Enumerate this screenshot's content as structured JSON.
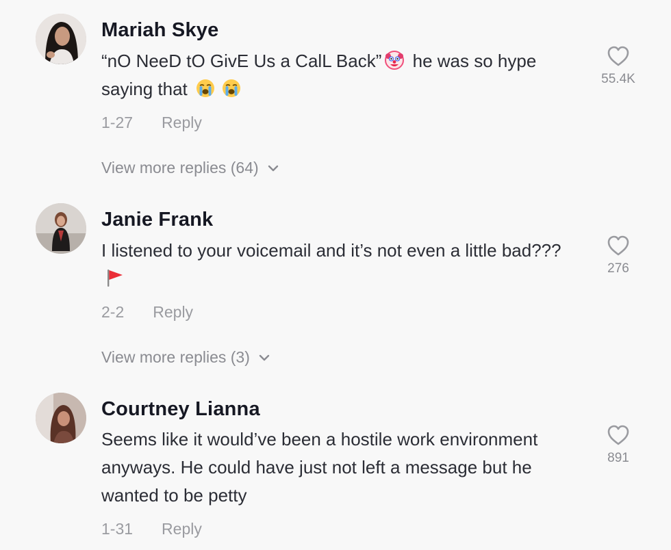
{
  "comments": [
    {
      "username": "Mariah Skye",
      "text_part1": "“nO NeeD tO GivE Us a CalL Back”",
      "text_part2": "he was so hype saying that",
      "date": "1-27",
      "reply_label": "Reply",
      "likes": "55.4K",
      "view_more": "View more replies (64)",
      "emojis": [
        "clown-face",
        "loudly-crying-face",
        "loudly-crying-face"
      ]
    },
    {
      "username": "Janie Frank",
      "text_part1": "I listened to your voicemail and it’s not even a little bad???",
      "date": "2-2",
      "reply_label": "Reply",
      "likes": "276",
      "view_more": "View more replies (3)",
      "emojis": [
        "red-flag"
      ]
    },
    {
      "username": "Courtney Lianna",
      "text_part1": "Seems like it would’ve been a hostile work environment anyways. He could have just not left a message but he wanted to be petty",
      "date": "1-31",
      "reply_label": "Reply",
      "likes": "891"
    }
  ],
  "icons": {
    "like": "heart-outline-icon",
    "expand": "chevron-down-icon"
  },
  "colors": {
    "background": "#f8f8f8",
    "username": "#161823",
    "text": "#2b2d35",
    "muted": "#9a9ba0"
  }
}
